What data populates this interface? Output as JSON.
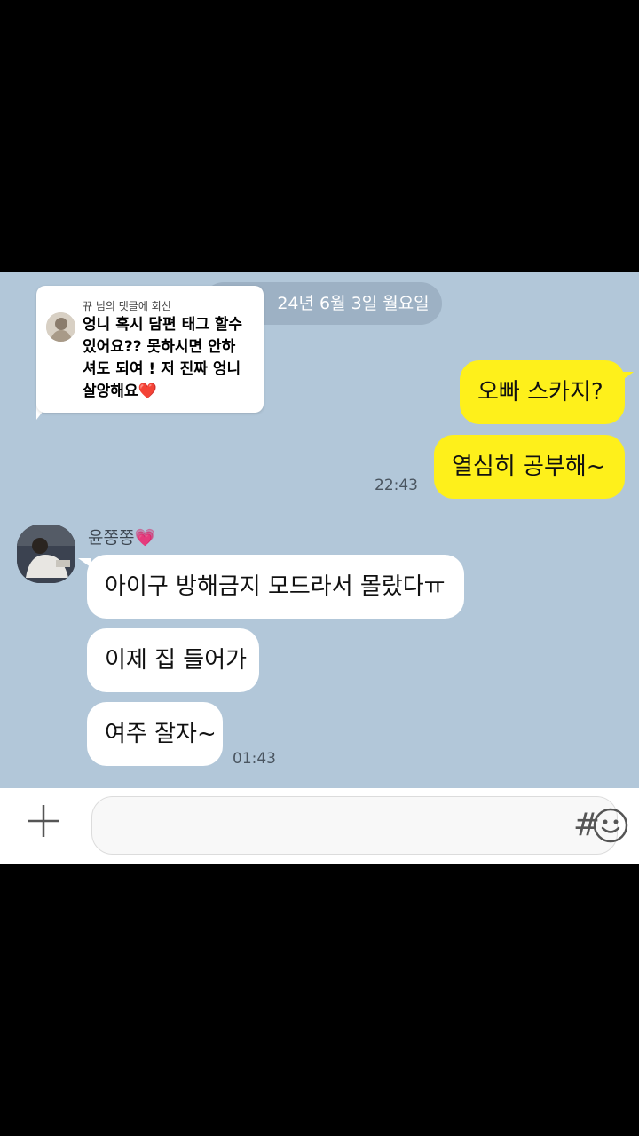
{
  "chat": {
    "date_label": "24년 6월 3일 월요일",
    "messages_mine": [
      {
        "text": "오빠 스카지?"
      },
      {
        "text": "열심히 공부해~"
      }
    ],
    "mine_time": "22:43",
    "sender_name": "윤쫑쫑",
    "sender_emoji": "💗",
    "messages_theirs": [
      {
        "text": "아이구 방해금지 모드라서 몰랐다ㅠ"
      },
      {
        "text": "이제 집 들어가"
      },
      {
        "text": "여주 잘자~"
      }
    ],
    "theirs_time": "01:43"
  },
  "reply_card": {
    "header": "뀨 님의 댓글에 회신",
    "text": "엉니 혹시 담편 태그 할수\n있어요?? 못하시면 안하\n셔도 되여 ! 저 진짜 엉니\n살앙해요",
    "heart": "❤️"
  },
  "input_bar": {
    "hash_label": "#",
    "icons": [
      "plus-icon",
      "emoji-icon",
      "hash-icon"
    ]
  },
  "colors": {
    "chat_bg": "#b2c7d9",
    "mine_bubble": "#fef01b",
    "theirs_bubble": "#ffffff"
  }
}
